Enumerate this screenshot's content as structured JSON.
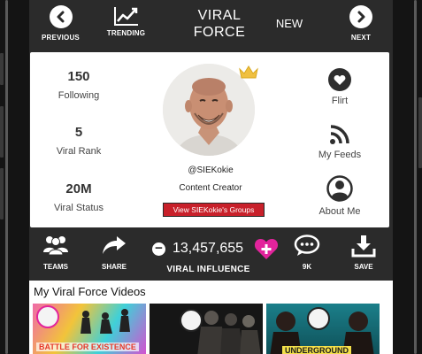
{
  "topnav": {
    "previous_label": "PREVIOUS",
    "trending_label": "TRENDING",
    "title_line1": "VIRAL",
    "title_line2": "FORCE",
    "new_label": "NEW",
    "next_label": "NEXT",
    "previous_icon": "chevron-left-icon",
    "next_icon": "chevron-right-icon",
    "trending_icon": "trending-chart-icon"
  },
  "profile": {
    "handle": "@SIEKokie",
    "role": "Content Creator",
    "groups_button": "View SIEKokie's Groups",
    "stats": [
      {
        "value": "150",
        "label": "Following"
      },
      {
        "value": "5",
        "label": "Viral Rank"
      },
      {
        "value": "20M",
        "label": "Viral Status"
      }
    ],
    "actions": [
      {
        "label": "Flirt",
        "icon": "heart-icon"
      },
      {
        "label": "My Feeds",
        "icon": "rss-icon"
      },
      {
        "label": "About Me",
        "icon": "user-icon"
      }
    ],
    "crown_icon": "crown-icon",
    "crown_color": "#f0c040",
    "button_color": "#c8202a"
  },
  "actionbar": {
    "teams_label": "TEAMS",
    "share_label": "SHARE",
    "influence_value": "13,457,655",
    "influence_label": "VIRAL INFLUENCE",
    "messages_label": "9K",
    "save_label": "SAVE",
    "heart_plus_color": "#e2249c"
  },
  "videos": {
    "title": "My Viral Force Videos",
    "items": [
      {
        "caption": "BATTLE FOR EXISTENCE"
      },
      {
        "caption": ""
      },
      {
        "caption": "UNDERGROUND"
      }
    ]
  },
  "colors": {
    "bar_bg": "#2b2b2b",
    "text_dark": "#333333"
  }
}
